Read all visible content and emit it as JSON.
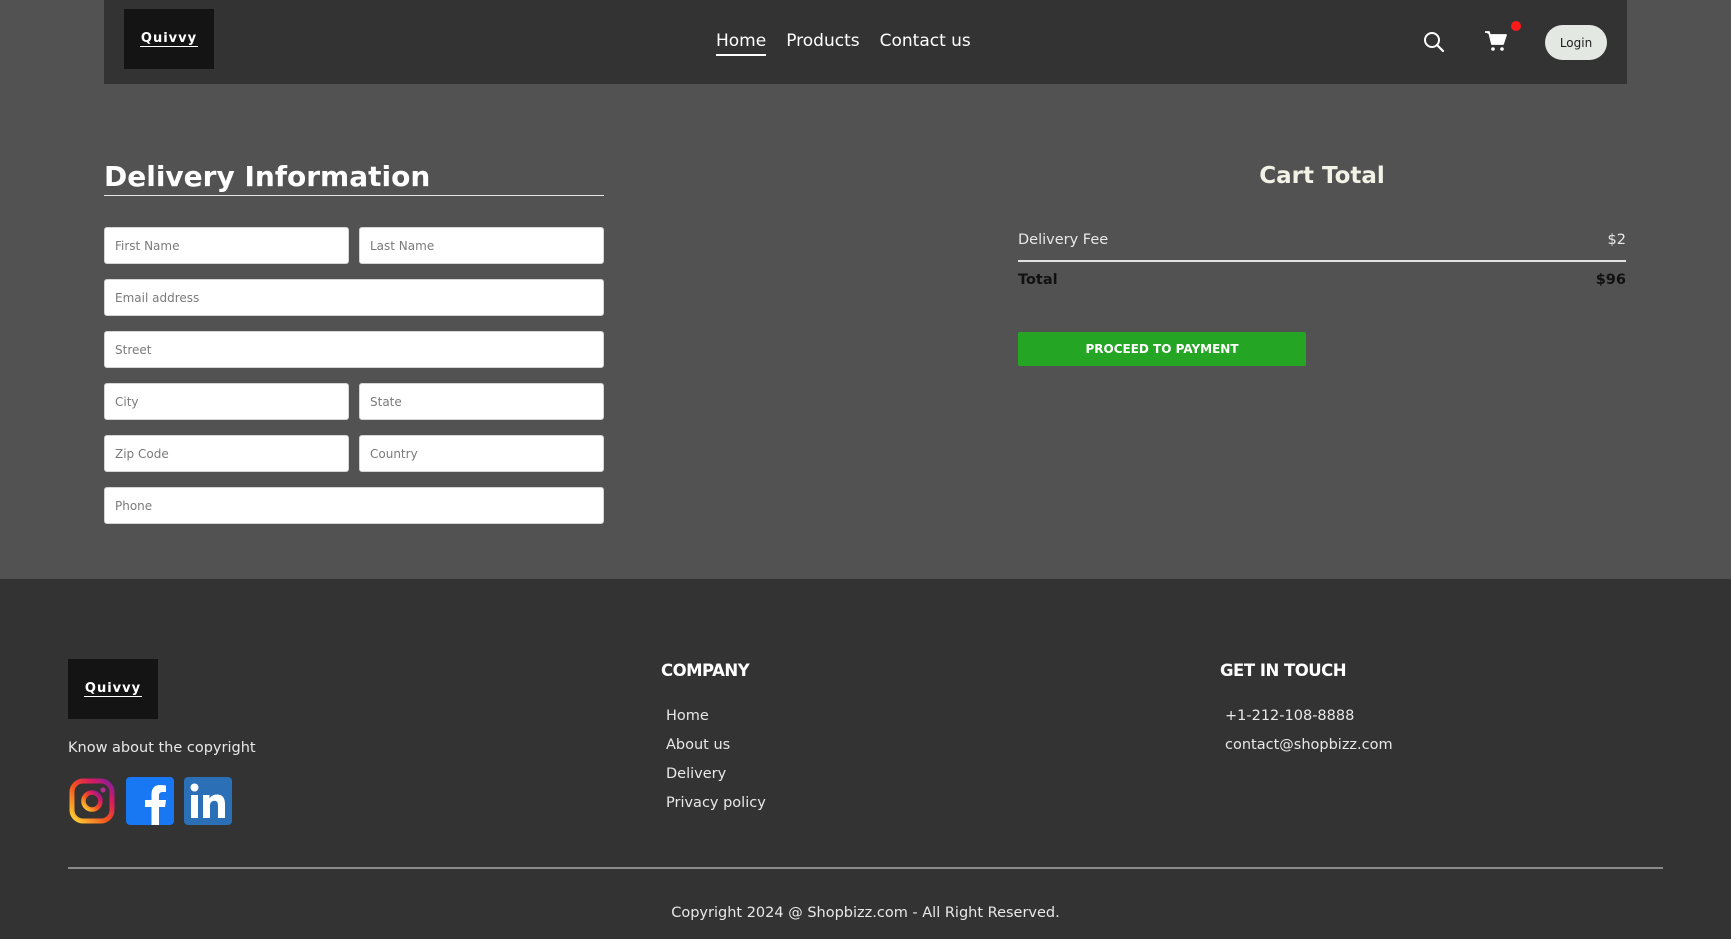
{
  "header": {
    "logo_text": "Quivvy",
    "nav": [
      "Home",
      "Products",
      "Contact us"
    ],
    "active_nav": "Home",
    "login_label": "Login",
    "icons": [
      "search-icon",
      "cart-icon"
    ]
  },
  "delivery": {
    "title": "Delivery Information",
    "placeholders": {
      "first_name": "First Name",
      "last_name": "Last Name",
      "email": "Email address",
      "street": "Street",
      "city": "City",
      "state": "State",
      "zip": "Zip Code",
      "country": "Country",
      "phone": "Phone"
    }
  },
  "cart": {
    "title": "Cart Total",
    "delivery_fee_label": "Delivery Fee",
    "delivery_fee_value": "$2",
    "total_label": "Total",
    "total_value": "$96",
    "proceed_label": "PROCEED TO PAYMENT"
  },
  "footer": {
    "logo_text": "Quivvy",
    "tagline": "Know about the copyright",
    "social": [
      "instagram-icon",
      "facebook-icon",
      "linkedin-icon"
    ],
    "company": {
      "heading": "COMPANY",
      "links": [
        "Home",
        "About us",
        "Delivery",
        "Privacy policy"
      ]
    },
    "contact": {
      "heading": "GET IN TOUCH",
      "phone": "+1-212-108-8888",
      "email": "contact@shopbizz.com"
    },
    "copyright": "Copyright 2024 @ Shopbizz.com - All Right Reserved."
  },
  "colors": {
    "header_bg": "#333333",
    "page_bg": "#525252",
    "accent_green": "#24a624",
    "cart_badge": "#ff1a1a"
  }
}
